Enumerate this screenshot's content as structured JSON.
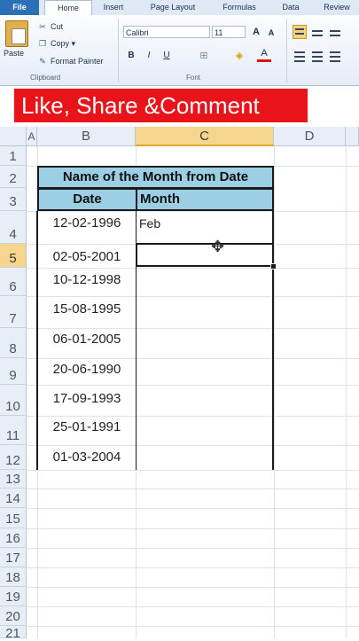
{
  "ribbon": {
    "tabs": [
      "File",
      "Home",
      "Insert",
      "Page Layout",
      "Formulas",
      "Data",
      "Review"
    ],
    "active_tab": "Home",
    "clipboard": {
      "paste_label": "Paste",
      "cut_label": "Cut",
      "copy_label": "Copy ▾",
      "format_painter_label": "Format Painter",
      "group_label": "Clipboard"
    },
    "font": {
      "font_name": "Calibri",
      "font_size": "11",
      "group_label": "Font"
    }
  },
  "banner": {
    "text": "Like, Share &Comment"
  },
  "grid": {
    "columns": [
      "A",
      "B",
      "C",
      "D"
    ],
    "rows": [
      "1",
      "2",
      "3",
      "4",
      "5",
      "6",
      "7",
      "8",
      "9",
      "10",
      "11",
      "12",
      "13",
      "14",
      "15",
      "16",
      "17",
      "18",
      "19",
      "20",
      "21"
    ]
  },
  "table": {
    "title": "Name of the Month from Date",
    "headers": [
      "Date",
      "Month"
    ],
    "dates": [
      "12-02-1996",
      "02-05-2001",
      "10-12-1998",
      "15-08-1995",
      "06-01-2005",
      "20-06-1990",
      "17-09-1993",
      "25-01-1991",
      "01-03-2004"
    ],
    "months": [
      "Feb"
    ]
  },
  "selection": {
    "active_cell": "C5"
  }
}
